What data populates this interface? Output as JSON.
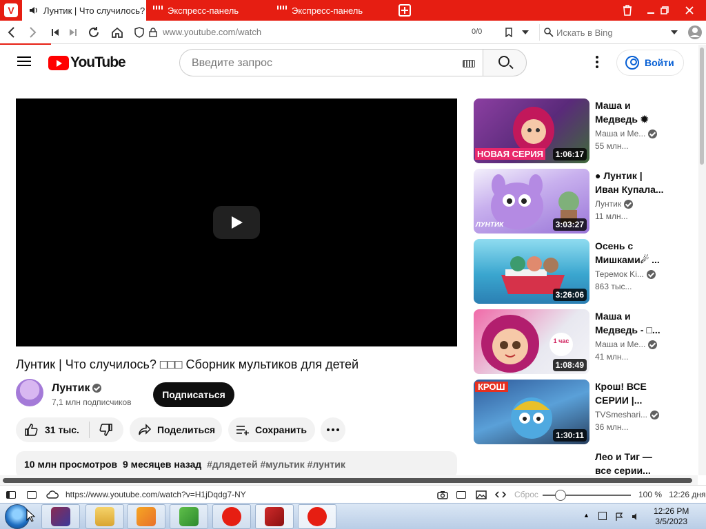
{
  "browser": {
    "tabs": [
      {
        "label": "Лунтик | Что случилось? ",
        "active": true
      },
      {
        "label": "Экспресс-панель"
      },
      {
        "label": "Экспресс-панель"
      }
    ],
    "url": "www.youtube.com/watch",
    "counter": "0/0",
    "search_placeholder": "Искать в Bing",
    "accent": "#e61e12"
  },
  "youtube": {
    "logo": "YouTube",
    "search_placeholder": "Введите запрос",
    "signin": "Войти",
    "video": {
      "title": "Лунтик | Что случилось? □□□ Сборник мультиков для детей",
      "channel": "Лунтик",
      "subscribers": "7,1 млн подписчиков",
      "subscribe": "Подписаться",
      "likes": "31 тыс.",
      "share": "Поделиться",
      "save": "Сохранить",
      "views": "10 млн просмотров",
      "date": "9 месяцев назад",
      "tags": "#длядетей #мультик #лунтик"
    },
    "recommendations": [
      {
        "title": "Маша и Медведь ✹",
        "channel": "Маша и Ме...",
        "views": "55 млн...",
        "duration": "1:06:17",
        "badge": "НОВАЯ СЕРИЯ",
        "thumb_color": "#7a3f95"
      },
      {
        "title": "● Лунтик | Иван Купала...",
        "channel": "Лунтик",
        "views": "11 млн...",
        "duration": "3:03:27",
        "badge": "ЛУНТИК",
        "thumb_color": "#b78ee6"
      },
      {
        "title": "Осень с Мишками☄ ...",
        "channel": "Теремок Ki...",
        "views": "863 тыс...",
        "duration": "3:26:06",
        "badge": "",
        "thumb_color": "#4fb8d8"
      },
      {
        "title": "Маша и Медведь - □...",
        "channel": "Маша и Ме...",
        "views": "41 млн...",
        "duration": "1:08:49",
        "badge": "1 час",
        "thumb_color": "#e85aa4"
      },
      {
        "title": "Крош! ВСЕ СЕРИИ |...",
        "channel": "TVSmeshari...",
        "views": "36 млн...",
        "duration": "1:30:11",
        "badge": "КРОШ",
        "thumb_color": "#4a88c8"
      },
      {
        "title": "Лео и Тиг — все серии...",
        "channel": "",
        "views": "",
        "duration": "",
        "badge": "",
        "thumb_color": "#ffffff"
      }
    ]
  },
  "statusbar": {
    "link": "https://www.youtube.com/watch?v=H1jDqdg7-NY",
    "reset": "Сброс",
    "zoom": "100 %",
    "time": "12:26 дня"
  },
  "taskbar": {
    "time": "12:26 PM",
    "date": "3/5/2023"
  }
}
